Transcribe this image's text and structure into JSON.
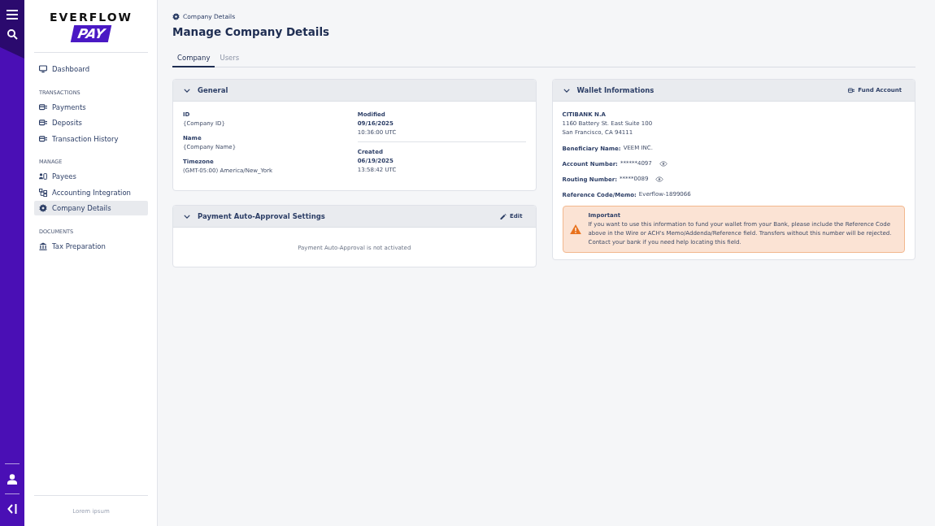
{
  "logo": {
    "wordmark": "EVERFLOW",
    "badge": "PAY"
  },
  "nav": [
    {
      "items": [
        {
          "label": "Dashboard",
          "kind": "monitor",
          "selected": false
        }
      ]
    },
    {
      "heading": "TRANSACTIONS",
      "items": [
        {
          "label": "Payments",
          "kind": "card",
          "selected": false
        },
        {
          "label": "Deposits",
          "kind": "card",
          "selected": false
        },
        {
          "label": "Transaction History",
          "kind": "card",
          "selected": false
        }
      ]
    },
    {
      "heading": "MANAGE",
      "items": [
        {
          "label": "Payees",
          "kind": "people",
          "selected": false
        },
        {
          "label": "Accounting Integration",
          "kind": "org",
          "selected": false
        },
        {
          "label": "Company Details",
          "kind": "gear",
          "selected": true
        }
      ]
    },
    {
      "heading": "DOCUMENTS",
      "items": [
        {
          "label": "Tax Preparation",
          "kind": "bank",
          "selected": false
        }
      ]
    }
  ],
  "sidebar_footer": "Lorem ipsum",
  "breadcrumb": "Company Details",
  "title": "Manage Company Details",
  "tabs": [
    {
      "label": "Company",
      "selected": true
    },
    {
      "label": "Users",
      "selected": false
    }
  ],
  "general": {
    "title": "General",
    "expanded": true,
    "fields": [
      {
        "label": "ID",
        "value": "{Company ID}"
      },
      {
        "label": "Name",
        "value": "{Company Name}"
      },
      {
        "label": "Timezone",
        "value": "(GMT-05:00) America/New_York"
      }
    ],
    "stamps": [
      {
        "label": "Modified",
        "date": "09/16/2025",
        "time": "10:36:00 UTC"
      },
      {
        "label": "Created",
        "date": "06/19/2025",
        "time": "13:58:42 UTC"
      }
    ]
  },
  "approval": {
    "title": "Payment Auto-Approval Settings",
    "expanded": true,
    "action": "Edit",
    "message": "Payment Auto-Approval is not activated"
  },
  "wallet": {
    "title": "Wallet Informations",
    "expanded": true,
    "action": "Fund Account",
    "bank": "CITIBANK N.A",
    "address": [
      "1160 Battery St. East Suite 100",
      "San Francisco, CA 94111"
    ],
    "rows": [
      {
        "label": "Beneficiary Name:",
        "value": "VEEM INC.",
        "kind": "plain"
      },
      {
        "label": "Account Number:",
        "value": "******4097",
        "kind": "secret"
      },
      {
        "label": "Routing Number:",
        "value": "*****0089",
        "kind": "secret"
      },
      {
        "label": "Reference Code/Memo:",
        "value": "Everflow-1899066",
        "kind": "plain"
      }
    ],
    "notice": {
      "title": "Important",
      "text": "If you want to use this information to fund your wallet from your Bank, please include the Reference Code above in the Wire or ACH's Memo/Addenda/Reference field. Transfers without this number will be rejected. Contact your bank if you need help locating this field."
    }
  }
}
